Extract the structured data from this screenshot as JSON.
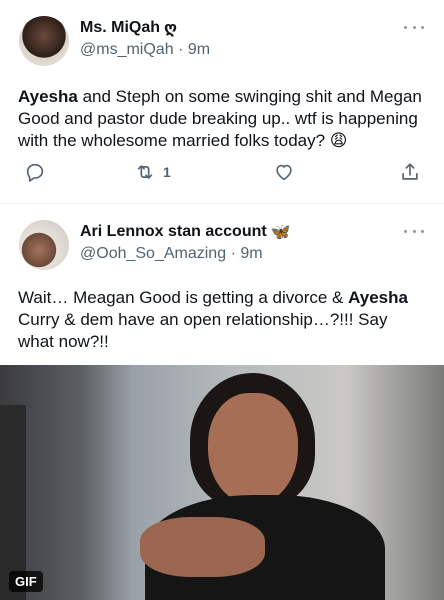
{
  "tweets": [
    {
      "author": {
        "name": "Ms. MiQah",
        "name_suffix": "ღ",
        "handle": "@ms_miQah",
        "time": "9m"
      },
      "text_parts": [
        {
          "bold": "Ayesha"
        },
        {
          "plain": " and Steph on some swinging shit and Megan Good and pastor dude breaking up.. wtf is happening with the wholesome married folks today? 😩"
        }
      ],
      "actions": {
        "reply_icon": "reply-icon",
        "retweet_icon": "retweet-icon",
        "retweet_count": "1",
        "like_icon": "heart-icon",
        "share_icon": "share-icon"
      }
    },
    {
      "author": {
        "name": "Ari Lennox stan account",
        "name_suffix": "🦋",
        "handle": "@Ooh_So_Amazing",
        "time": "9m"
      },
      "text_parts": [
        {
          "plain": "Wait… Meagan Good is getting a divorce & "
        },
        {
          "bold": "Ayesha"
        },
        {
          "plain": " Curry & dem have an open relationship…?!!! Say what now?!!"
        }
      ],
      "media": {
        "type": "gif",
        "badge": "GIF"
      }
    }
  ],
  "separator": "·",
  "colors": {
    "text": "#0f1419",
    "secondary": "#536471",
    "border": "#eff3f4",
    "icon": "#536471"
  }
}
